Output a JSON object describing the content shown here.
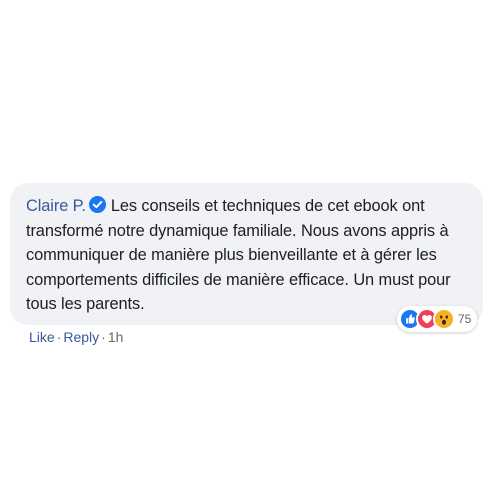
{
  "comment": {
    "author": "Claire P.",
    "verified_icon": "verified-badge-icon",
    "text": "Les conseils et techniques de cet ebook ont transformé notre dynamique familiale. Nous avons appris à communiquer de manière plus bienveillante et à gérer les comportements difficiles de manière efficace. Un must pour tous les parents."
  },
  "reactions": {
    "icons": [
      "like-reaction-icon",
      "love-reaction-icon",
      "wow-reaction-icon"
    ],
    "count": "75"
  },
  "actions": {
    "like_label": "Like",
    "separator": "·",
    "reply_label": "Reply",
    "time": "1h"
  },
  "colors": {
    "bubble_background": "#f0f2f5",
    "link_blue": "#385898",
    "badge_blue": "#1877f2",
    "love_red": "#f33e58",
    "wow_yellow": "#f7b125",
    "secondary_text": "#65676b"
  }
}
